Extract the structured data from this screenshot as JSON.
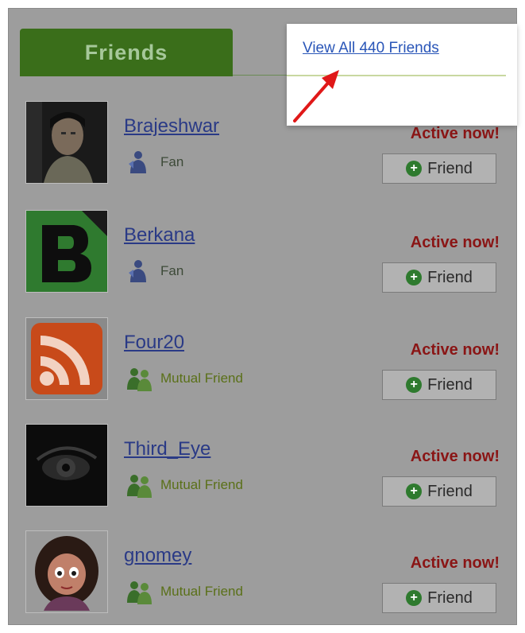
{
  "tab": {
    "label": "Friends"
  },
  "view_all": {
    "label": "View All 440 Friends"
  },
  "friends": [
    {
      "name": "Brajeshwar",
      "relation": "Fan",
      "relation_type": "fan",
      "status": "Active now!",
      "button": "Friend",
      "avatar": "photo-man-icon"
    },
    {
      "name": "Berkana",
      "relation": "Fan",
      "relation_type": "fan",
      "status": "Active now!",
      "button": "Friend",
      "avatar": "letter-b-logo-icon"
    },
    {
      "name": "Four20",
      "relation": "Mutual Friend",
      "relation_type": "mutual",
      "status": "Active now!",
      "button": "Friend",
      "avatar": "rss-feed-icon"
    },
    {
      "name": "Third_Eye",
      "relation": "Mutual Friend",
      "relation_type": "mutual",
      "status": "Active now!",
      "button": "Friend",
      "avatar": "eye-photo-icon"
    },
    {
      "name": "gnomey",
      "relation": "Mutual Friend",
      "relation_type": "mutual",
      "status": "Active now!",
      "button": "Friend",
      "avatar": "cartoon-girl-icon"
    }
  ],
  "colors": {
    "panel_bg": "#9d9d9d",
    "tab_bg": "#3a6e1a",
    "link": "#2a56b8",
    "status": "#8a1515",
    "arrow": "#e01818"
  }
}
